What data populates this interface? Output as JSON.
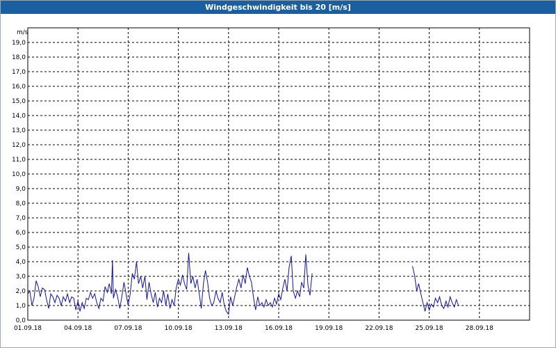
{
  "chart_data": {
    "type": "line",
    "title": "Windgeschwindigkeit bis 20 [m/s]",
    "ylabel": "m/s",
    "xlabel": "",
    "ylim": [
      0,
      20
    ],
    "xlim": [
      "01.09.18",
      "01.10.18"
    ],
    "grid": true,
    "line_color": "#1010a0",
    "y_ticks": [
      "0,0",
      "1,0",
      "2,0",
      "3,0",
      "4,0",
      "5,0",
      "6,0",
      "7,0",
      "8,0",
      "9,0",
      "10,0",
      "11,0",
      "12,0",
      "13,0",
      "14,0",
      "15,0",
      "16,0",
      "17,0",
      "18,0",
      "19,0"
    ],
    "x_ticks": [
      "01.09.18",
      "04.09.18",
      "07.09.18",
      "10.09.18",
      "13.09.18",
      "16.09.18",
      "19.09.18",
      "22.09.18",
      "25.09.18",
      "28.09.18"
    ],
    "series": [
      {
        "values": [
          [
            [
              0.0,
              1.8
            ],
            [
              0.12,
              2.0
            ],
            [
              0.25,
              1.0
            ],
            [
              0.37,
              1.5
            ],
            [
              0.5,
              2.7
            ],
            [
              0.62,
              2.3
            ],
            [
              0.75,
              1.6
            ],
            [
              0.87,
              2.2
            ],
            [
              1.0,
              2.1
            ],
            [
              1.12,
              1.4
            ],
            [
              1.25,
              0.8
            ],
            [
              1.37,
              1.8
            ],
            [
              1.5,
              1.6
            ],
            [
              1.62,
              1.2
            ],
            [
              1.75,
              1.7
            ],
            [
              1.87,
              1.5
            ],
            [
              2.0,
              1.0
            ],
            [
              2.12,
              1.6
            ],
            [
              2.25,
              1.3
            ],
            [
              2.37,
              1.8
            ],
            [
              2.5,
              1.2
            ],
            [
              2.62,
              1.6
            ],
            [
              2.75,
              1.5
            ],
            [
              2.87,
              0.7
            ],
            [
              3.0,
              1.3
            ],
            [
              3.12,
              0.6
            ],
            [
              3.25,
              1.2
            ],
            [
              3.37,
              0.8
            ],
            [
              3.5,
              1.5
            ],
            [
              3.62,
              1.4
            ],
            [
              3.75,
              1.9
            ],
            [
              3.87,
              1.5
            ],
            [
              4.0,
              1.8
            ],
            [
              4.12,
              1.2
            ],
            [
              4.25,
              0.8
            ],
            [
              4.37,
              1.5
            ],
            [
              4.5,
              1.3
            ],
            [
              4.62,
              2.3
            ],
            [
              4.75,
              1.9
            ],
            [
              4.87,
              2.5
            ],
            [
              5.0,
              1.8
            ],
            [
              5.06,
              4.1
            ],
            [
              5.12,
              1.5
            ],
            [
              5.25,
              2.1
            ],
            [
              5.37,
              1.6
            ],
            [
              5.5,
              0.8
            ],
            [
              5.62,
              1.6
            ],
            [
              5.75,
              2.6
            ],
            [
              5.87,
              1.8
            ],
            [
              6.0,
              1.0
            ],
            [
              6.12,
              1.8
            ],
            [
              6.25,
              3.2
            ],
            [
              6.37,
              2.8
            ],
            [
              6.5,
              4.0
            ],
            [
              6.62,
              2.5
            ],
            [
              6.75,
              3.0
            ],
            [
              6.87,
              2.2
            ],
            [
              7.0,
              3.0
            ],
            [
              7.12,
              1.4
            ],
            [
              7.25,
              2.6
            ],
            [
              7.37,
              1.8
            ],
            [
              7.5,
              1.2
            ],
            [
              7.62,
              1.9
            ],
            [
              7.75,
              0.9
            ],
            [
              7.87,
              1.5
            ],
            [
              8.0,
              1.2
            ],
            [
              8.12,
              2.0
            ],
            [
              8.25,
              1.0
            ],
            [
              8.37,
              1.8
            ],
            [
              8.5,
              0.8
            ],
            [
              8.62,
              1.4
            ],
            [
              8.75,
              1.0
            ],
            [
              8.87,
              2.2
            ],
            [
              9.0,
              2.8
            ],
            [
              9.12,
              2.4
            ],
            [
              9.25,
              3.1
            ],
            [
              9.37,
              2.5
            ],
            [
              9.5,
              2.1
            ],
            [
              9.62,
              4.6
            ],
            [
              9.75,
              2.5
            ],
            [
              9.87,
              3.0
            ],
            [
              10.0,
              2.2
            ],
            [
              10.12,
              2.8
            ],
            [
              10.25,
              1.8
            ],
            [
              10.37,
              0.8
            ],
            [
              10.5,
              2.5
            ],
            [
              10.62,
              3.4
            ],
            [
              10.75,
              2.6
            ],
            [
              10.87,
              1.5
            ],
            [
              11.0,
              1.0
            ],
            [
              11.12,
              1.2
            ],
            [
              11.25,
              2.0
            ],
            [
              11.37,
              1.5
            ],
            [
              11.5,
              1.2
            ],
            [
              11.62,
              1.9
            ],
            [
              11.75,
              1.0
            ],
            [
              11.87,
              0.6
            ],
            [
              12.0,
              0.4
            ],
            [
              12.12,
              1.6
            ],
            [
              12.25,
              1.0
            ],
            [
              12.37,
              1.6
            ],
            [
              12.5,
              2.3
            ],
            [
              12.62,
              2.8
            ],
            [
              12.75,
              2.2
            ],
            [
              12.87,
              3.1
            ],
            [
              13.0,
              2.5
            ],
            [
              13.12,
              3.6
            ],
            [
              13.25,
              3.0
            ],
            [
              13.37,
              2.6
            ],
            [
              13.5,
              1.5
            ],
            [
              13.62,
              0.7
            ],
            [
              13.75,
              1.6
            ],
            [
              13.87,
              1.0
            ],
            [
              14.0,
              1.2
            ],
            [
              14.12,
              0.9
            ],
            [
              14.25,
              1.4
            ],
            [
              14.37,
              1.0
            ],
            [
              14.5,
              1.2
            ],
            [
              14.62,
              0.9
            ],
            [
              14.75,
              1.5
            ],
            [
              14.87,
              1.1
            ],
            [
              15.0,
              1.8
            ],
            [
              15.12,
              1.4
            ],
            [
              15.25,
              2.2
            ],
            [
              15.37,
              2.8
            ],
            [
              15.5,
              2.0
            ],
            [
              15.62,
              3.6
            ],
            [
              15.75,
              4.4
            ],
            [
              15.87,
              2.0
            ],
            [
              16.0,
              1.5
            ],
            [
              16.12,
              2.0
            ],
            [
              16.25,
              1.6
            ],
            [
              16.37,
              2.6
            ],
            [
              16.5,
              2.2
            ],
            [
              16.62,
              4.5
            ],
            [
              16.75,
              2.4
            ],
            [
              16.87,
              1.7
            ],
            [
              17.0,
              3.2
            ]
          ],
          [
            [
              23.0,
              3.7
            ],
            [
              23.12,
              3.1
            ],
            [
              23.25,
              2.0
            ],
            [
              23.37,
              2.5
            ],
            [
              23.5,
              1.8
            ],
            [
              23.62,
              1.2
            ],
            [
              23.75,
              0.6
            ],
            [
              23.87,
              1.2
            ],
            [
              24.0,
              0.7
            ],
            [
              24.12,
              1.1
            ],
            [
              24.25,
              0.9
            ],
            [
              24.37,
              1.5
            ],
            [
              24.5,
              1.2
            ],
            [
              24.62,
              1.6
            ],
            [
              24.75,
              1.0
            ],
            [
              24.87,
              0.8
            ],
            [
              25.0,
              1.3
            ],
            [
              25.12,
              0.9
            ],
            [
              25.25,
              1.6
            ],
            [
              25.37,
              1.2
            ],
            [
              25.5,
              0.9
            ],
            [
              25.62,
              1.4
            ],
            [
              25.75,
              1.0
            ]
          ]
        ]
      }
    ]
  }
}
